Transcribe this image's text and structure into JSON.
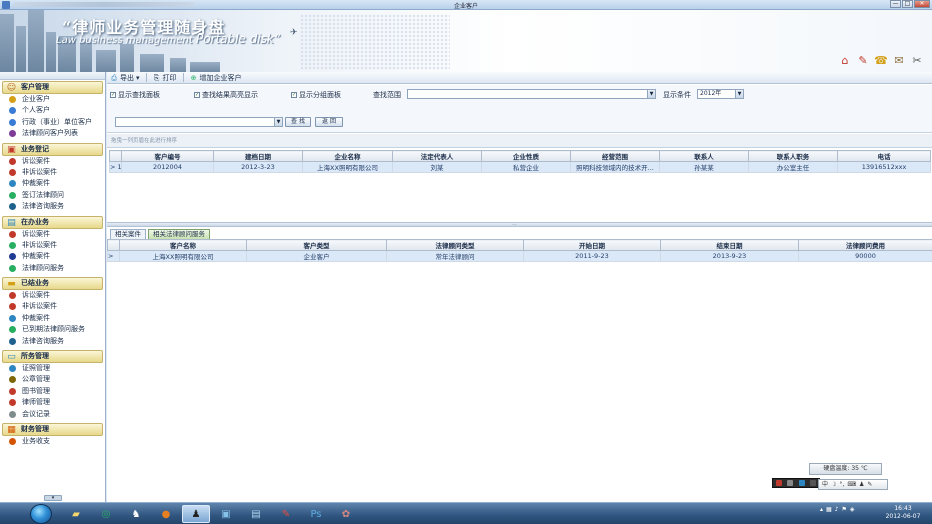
{
  "window": {
    "title": "企业客户",
    "minimize": "—",
    "maximize": "□",
    "close": "✕"
  },
  "banner": {
    "title_cn": "“律师业务管理随身盘",
    "title_en_small": "Law business management",
    "title_en_big": "Portable disk”"
  },
  "nav": {
    "sections": [
      {
        "key": "customer",
        "label": "客户管理",
        "items": [
          "企业客户",
          "个人客户",
          "行政（事业）单位客户",
          "法律顾问客户列表"
        ]
      },
      {
        "key": "register",
        "label": "业务登记",
        "items": [
          "诉讼案件",
          "非诉讼案件",
          "仲裁案件",
          "签订法律顾问",
          "法律咨询服务"
        ]
      },
      {
        "key": "ongoing",
        "label": "在办业务",
        "items": [
          "诉讼案件",
          "非诉讼案件",
          "仲裁案件",
          "法律顾问服务"
        ]
      },
      {
        "key": "closed",
        "label": "已结业务",
        "items": [
          "诉讼案件",
          "非诉讼案件",
          "仲裁案件",
          "已到期法律顾问服务",
          "法律咨询服务"
        ]
      },
      {
        "key": "office",
        "label": "所务管理",
        "items": [
          "证照管理",
          "公章管理",
          "图书管理",
          "律师管理",
          "会议记录"
        ]
      },
      {
        "key": "finance",
        "label": "财务管理",
        "items": [
          "业务收支"
        ]
      }
    ]
  },
  "toolbar": {
    "export": "导出",
    "print": "打印",
    "add": "增加企业客户"
  },
  "filters": {
    "show_search_panel": "显示查找面板",
    "highlight_results": "查找结果高亮显示",
    "show_group_panel": "显示分组面板",
    "search_range_label": "查找范围",
    "search_range_value": "",
    "condition_label": "显示条件",
    "condition_value": "2012年",
    "search_button": "查 找",
    "back_button": "返 回",
    "search_value": ""
  },
  "group_hint": "拖曳一列页眉在此进行排序",
  "customers": {
    "columns": [
      "客户编号",
      "建档日期",
      "企业名称",
      "法定代表人",
      "企业性质",
      "经营范围",
      "联系人",
      "联系人职务",
      "电话"
    ],
    "rows": [
      {
        "indicator": "> 1",
        "cells": [
          "2012004",
          "2012-3-23",
          "上海XX照明有限公司",
          "刘某",
          "私营企业",
          "照明科技领域内的技术开...",
          "孙某某",
          "办公室主任",
          "13916512xxx"
        ]
      }
    ]
  },
  "detail": {
    "tabs": [
      "相关案件",
      "相关法律顾问服务"
    ],
    "active_tab": 1,
    "columns": [
      "客户名称",
      "客户类型",
      "法律顾问类型",
      "开始日期",
      "结束日期",
      "法律顾问费用"
    ],
    "rows": [
      {
        "indicator": ">",
        "cells": [
          "上海XX照明有限公司",
          "企业客户",
          "常年法律顾问",
          "2011-9-23",
          "2013-9-23",
          "90000"
        ]
      }
    ]
  },
  "widgets": {
    "hdd_temp": "硬盘温度: 35 ℃",
    "ime": [
      "中",
      "☽",
      "°,",
      "⌨",
      "♟",
      "✎"
    ]
  },
  "taskbar": {
    "time": "16:43",
    "date": "2012-06-07"
  },
  "colors": {
    "accent": "#2f5580",
    "section_head": "#e6d889",
    "active_tab": "#c7e0b0"
  }
}
